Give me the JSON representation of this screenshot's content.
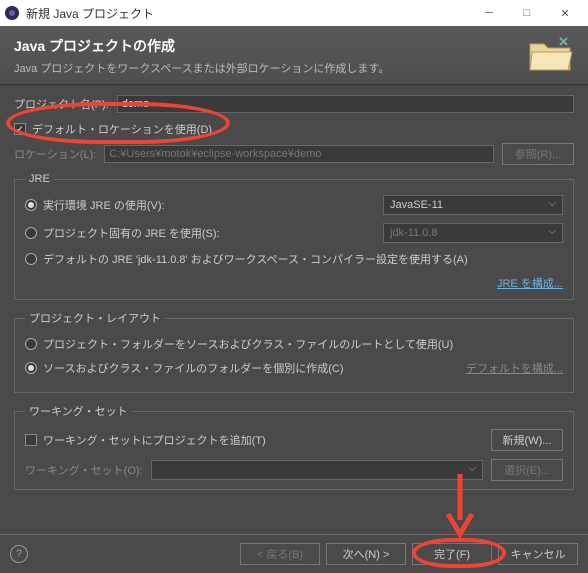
{
  "window": {
    "title": "新規 Java プロジェクト"
  },
  "header": {
    "title": "Java プロジェクトの作成",
    "desc": "Java プロジェクトをワークスペースまたは外部ロケーションに作成します。"
  },
  "project": {
    "name_label": "プロジェクト名(P):",
    "name_value": "demo",
    "use_default_label": "デフォルト・ロケーションを使用(D)",
    "location_label": "ロケーション(L):",
    "location_value": "C:¥Users¥motok¥eclipse-workspace¥demo",
    "browse_label": "参照(R)..."
  },
  "jre": {
    "legend": "JRE",
    "env_label": "実行環境 JRE の使用(V):",
    "env_value": "JavaSE-11",
    "project_label": "プロジェクト固有の JRE を使用(S):",
    "project_value": "jdk-11.0.8",
    "default_label": "デフォルトの JRE 'jdk-11.0.8' およびワークスペース・コンパイラー設定を使用する(A)",
    "configure_link": "JRE を構成..."
  },
  "layout": {
    "legend": "プロジェクト・レイアウト",
    "root_label": "プロジェクト・フォルダーをソースおよびクラス・ファイルのルートとして使用(U)",
    "separate_label": "ソースおよびクラス・ファイルのフォルダーを個別に作成(C)",
    "configure_link": "デフォルトを構成..."
  },
  "workingset": {
    "legend": "ワーキング・セット",
    "add_label": "ワーキング・セットにプロジェクトを追加(T)",
    "list_label": "ワーキング・セット(O):",
    "new_label": "新規(W)...",
    "select_label": "選択(E)..."
  },
  "footer": {
    "back": "< 戻る(B)",
    "next": "次へ(N) >",
    "finish": "完了(F)",
    "cancel": "キャンセル"
  }
}
